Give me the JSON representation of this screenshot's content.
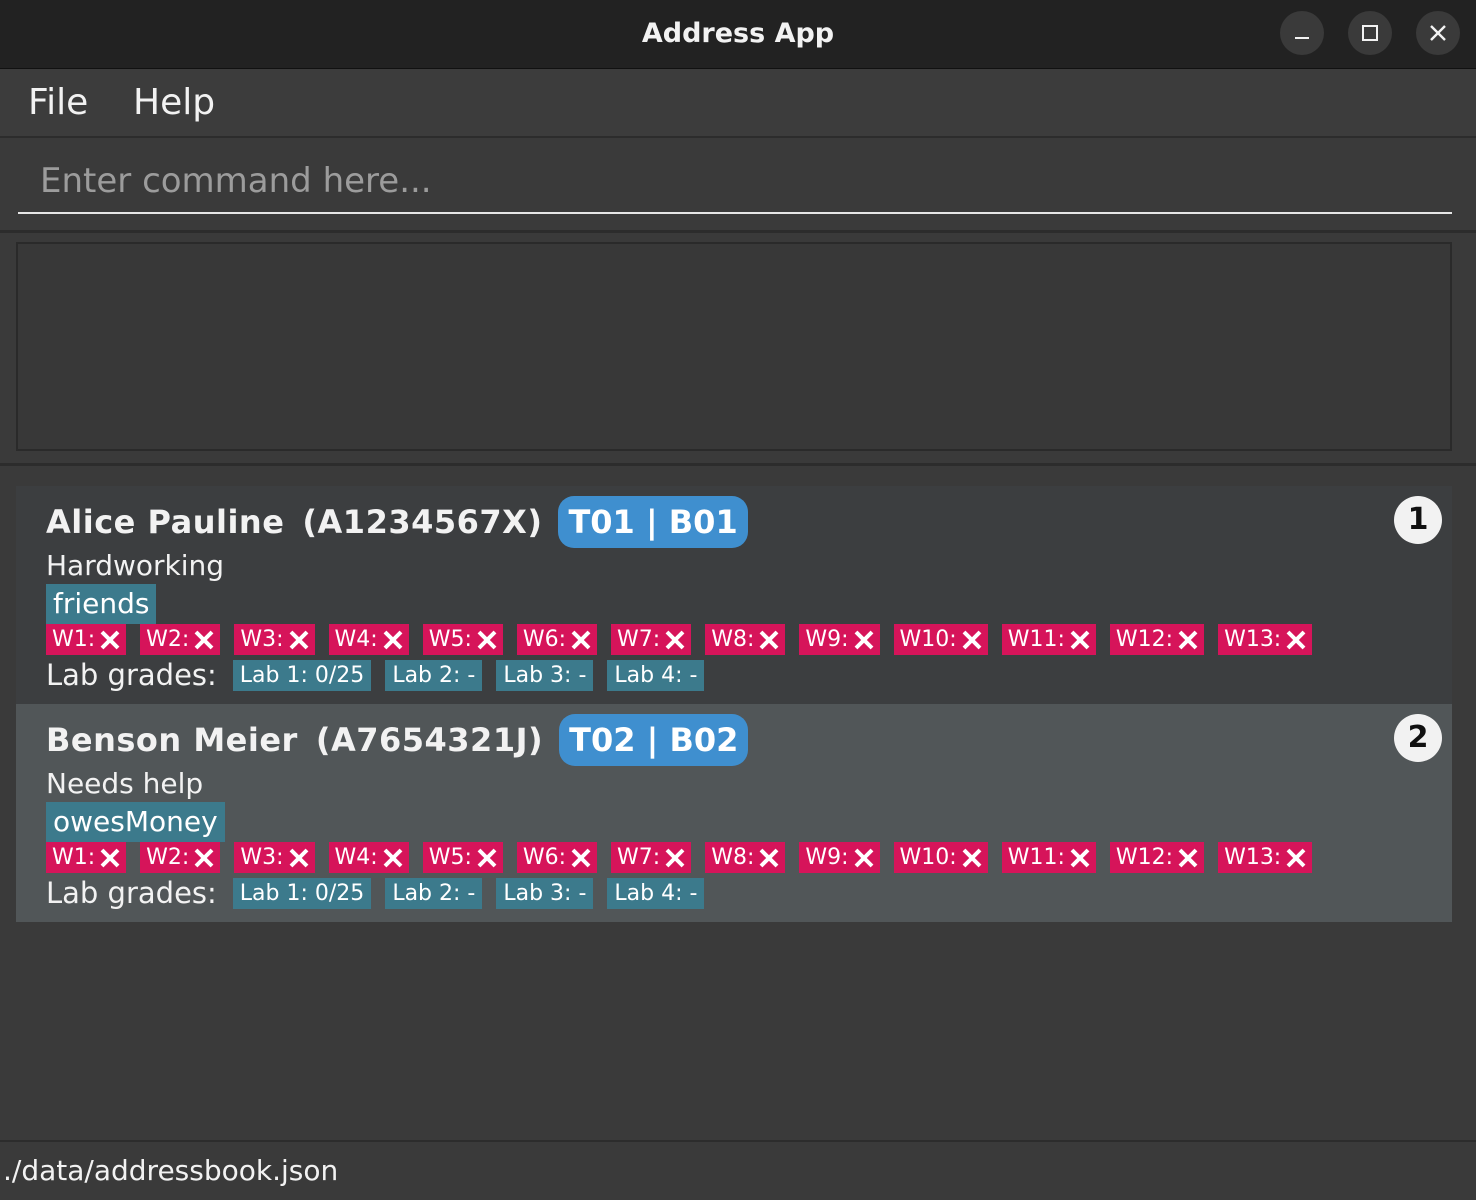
{
  "window": {
    "title": "Address App"
  },
  "menu": {
    "file": "File",
    "help": "Help"
  },
  "command": {
    "placeholder": "Enter command here...",
    "value": ""
  },
  "result": {
    "text": ""
  },
  "persons": [
    {
      "index": "1",
      "name": "Alice Pauline",
      "student_id": "(A1234567X)",
      "group": "T01 | B01",
      "remark": "Hardworking",
      "tag": "friends",
      "attendance": [
        "W1:",
        "W2:",
        "W3:",
        "W4:",
        "W5:",
        "W6:",
        "W7:",
        "W8:",
        "W9:",
        "W10:",
        "W11:",
        "W12:",
        "W13:"
      ],
      "labs_label": "Lab grades:",
      "labs": [
        "Lab 1: 0/25",
        "Lab 2: -",
        "Lab 3: -",
        "Lab 4: -"
      ]
    },
    {
      "index": "2",
      "name": "Benson Meier",
      "student_id": "(A7654321J)",
      "group": "T02 | B02",
      "remark": "Needs help",
      "tag": "owesMoney",
      "attendance": [
        "W1:",
        "W2:",
        "W3:",
        "W4:",
        "W5:",
        "W6:",
        "W7:",
        "W8:",
        "W9:",
        "W10:",
        "W11:",
        "W12:",
        "W13:"
      ],
      "labs_label": "Lab grades:",
      "labs": [
        "Lab 1: 0/25",
        "Lab 2: -",
        "Lab 3: -",
        "Lab 4: -"
      ]
    }
  ],
  "status": {
    "file_path": "./data/addressbook.json"
  },
  "icons": {
    "minimize": "minimize-icon",
    "maximize": "maximize-icon",
    "close": "close-icon",
    "absent": "cross-icon"
  },
  "colors": {
    "group_pill": "#3f8fcf",
    "absent_week": "#d6145a",
    "tag": "#3c7a8c"
  }
}
